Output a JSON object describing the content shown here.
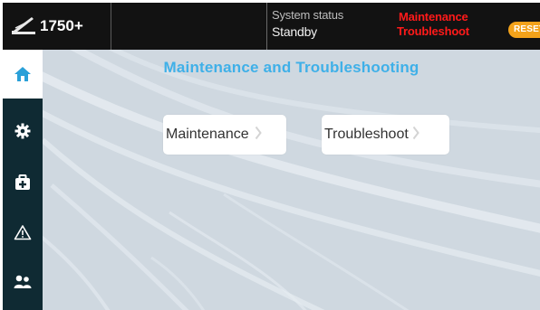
{
  "header": {
    "brand_name": "1750+",
    "status_label": "System status",
    "status_value": "Standby",
    "mode_line1": "Maintenance",
    "mode_line2": "Troubleshoot",
    "reset_label": "RESET"
  },
  "sidebar": {
    "items": [
      {
        "name": "home",
        "icon": "home-icon",
        "active": true
      },
      {
        "name": "settings",
        "icon": "gear-icon",
        "active": false
      },
      {
        "name": "toolbox",
        "icon": "toolbox-icon",
        "active": false
      },
      {
        "name": "alerts",
        "icon": "warning-icon",
        "active": false
      },
      {
        "name": "users",
        "icon": "users-icon",
        "active": false
      }
    ]
  },
  "main": {
    "title": "Maintenance and Troubleshooting",
    "buttons": [
      {
        "label": "Maintenance"
      },
      {
        "label": "Troubleshoot"
      }
    ]
  },
  "colors": {
    "accent": "#3fb0e8",
    "alert_red": "#ff1a1a",
    "reset_orange": "#f3a21a",
    "sidebar_bg": "#0f2a33",
    "main_bg": "#cfd8e0"
  }
}
